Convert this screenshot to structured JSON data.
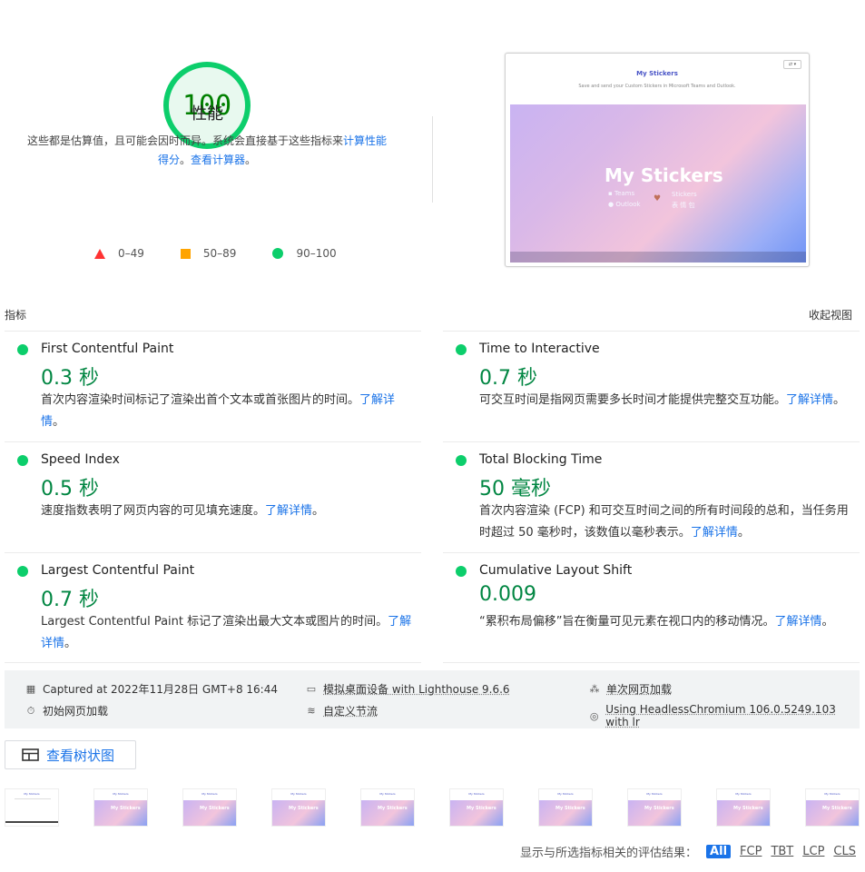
{
  "score": {
    "value": "100",
    "title": "性能",
    "desc_prefix": "这些都是估算值，且可能会因时而异。系统会直接基于这些指标来",
    "desc_link1": "计算性能得分",
    "desc_mid": "。",
    "desc_link2": "查看计算器",
    "desc_suffix": "。",
    "legend": [
      {
        "label": "0–49",
        "color": "#ff3333"
      },
      {
        "label": "50–89",
        "color": "#ffa400"
      },
      {
        "label": "90–100",
        "color": "#0cce6b"
      }
    ]
  },
  "screenshot": {
    "title": "My Stickers",
    "subtitle": "Save and send your Custom Stickers in Microsoft Teams and Outlook.",
    "hero_title": "My Stickers",
    "hero_left1": "Teams",
    "hero_left2": "Outlook",
    "hero_right1": "Stickers",
    "hero_right2": "表 情 包"
  },
  "metrics": {
    "header": "指标",
    "collapse": "收起视图",
    "items": [
      {
        "title": "First Contentful Paint",
        "value": "0.3 秒",
        "desc": "首次内容渲染时间标记了渲染出首个文本或首张图片的时间。",
        "link": "了解详情",
        "end": "。"
      },
      {
        "title": "Time to Interactive",
        "value": "0.7 秒",
        "desc": "可交互时间是指网页需要多长时间才能提供完整交互功能。",
        "link": "了解详情",
        "end": "。"
      },
      {
        "title": "Speed Index",
        "value": "0.5 秒",
        "desc": "速度指数表明了网页内容的可见填充速度。",
        "link": "了解详情",
        "end": "。"
      },
      {
        "title": "Total Blocking Time",
        "value": "50 毫秒",
        "desc": "首次内容渲染 (FCP) 和可交互时间之间的所有时间段的总和，当任务用时超过 50 毫秒时，该数值以毫秒表示。",
        "link": "了解详情",
        "end": "。"
      },
      {
        "title": "Largest Contentful Paint",
        "value": "0.7 秒",
        "desc": "Largest Contentful Paint 标记了渲染出最大文本或图片的时间。",
        "link": "了解详情",
        "end": "。"
      },
      {
        "title": "Cumulative Layout Shift",
        "value": "0.009",
        "desc": "“累积布局偏移”旨在衡量可见元素在视口内的移动情况。",
        "link": "了解详情",
        "end": "。"
      }
    ]
  },
  "info": {
    "captured": "Captured at 2022年11月28日 GMT+8 16:44",
    "initial_load": "初始网页加载",
    "device": "模拟桌面设备 with Lighthouse 9.6.6",
    "throttling": "自定义节流",
    "single_load": "单次网页加载",
    "browser": "Using HeadlessChromium 106.0.5249.103 with lr"
  },
  "treemap": {
    "label": "查看树状图"
  },
  "filmstrip": {
    "count": 10
  },
  "filter": {
    "label": "显示与所选指标相关的评估结果：",
    "chips": [
      "All",
      "FCP",
      "TBT",
      "LCP",
      "CLS"
    ]
  }
}
